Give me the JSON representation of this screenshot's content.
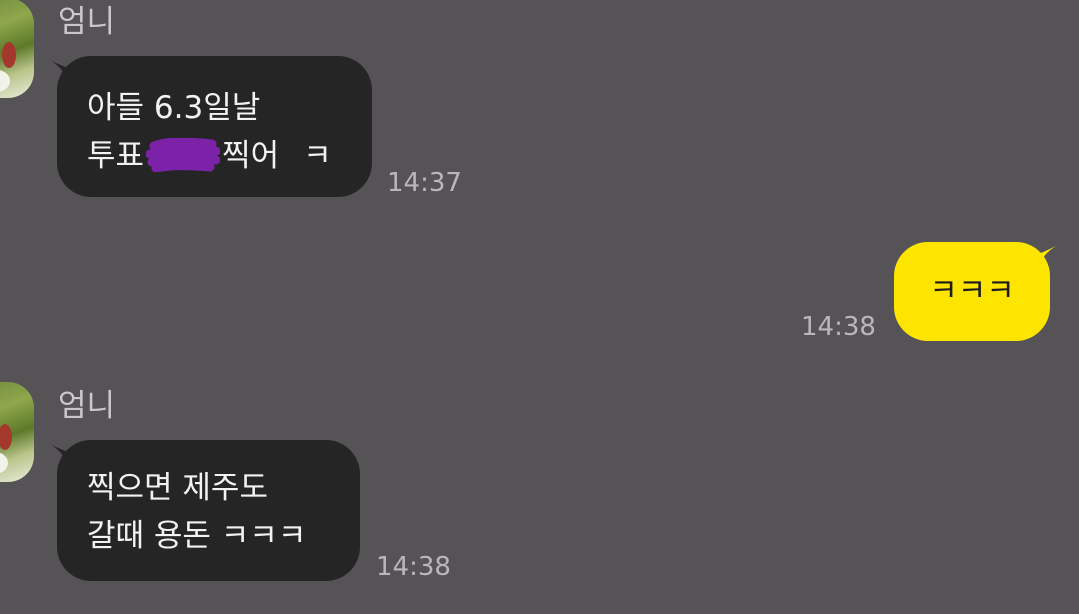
{
  "messages": [
    {
      "sender": "엄니",
      "lines": [
        "아들 6.3일날",
        "투표",
        "찍어",
        "ㅋ"
      ],
      "time": "14:37"
    },
    {
      "text": "ㅋㅋㅋ",
      "time": "14:38"
    },
    {
      "sender": "엄니",
      "lines": [
        "찍으면 제주도",
        "갈때 용돈 ㅋㅋㅋ"
      ],
      "time": "14:38"
    }
  ],
  "colors": {
    "background": "#555355",
    "incoming_bubble": "#262526",
    "outgoing_bubble": "#fee500",
    "redaction": "#7b22a8"
  },
  "icons": {
    "avatar": "profile-photo",
    "redaction": "purple-scribble"
  }
}
